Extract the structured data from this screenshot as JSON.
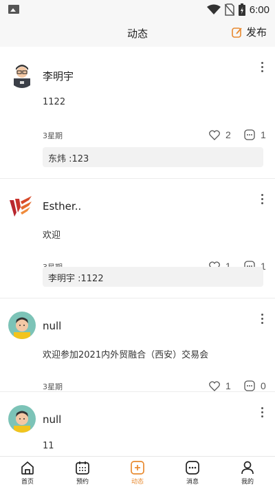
{
  "status_bar": {
    "time": "6:00"
  },
  "header": {
    "title": "动态",
    "publish_label": "发布"
  },
  "accent_color": "#e8892e",
  "posts": [
    {
      "author": "李明宇",
      "content": "1122",
      "time": "3星期",
      "likes": "2",
      "comments": "1",
      "reply": "东炜 :123"
    },
    {
      "author": "Esther..",
      "content": "欢迎",
      "time": "3星期",
      "likes": "1",
      "comments": "1",
      "reply": "李明宇 :1122"
    },
    {
      "author": "null",
      "content": "欢迎参加2021内外贸融合（西安）交易会",
      "time": "3星期",
      "likes": "1",
      "comments": "0"
    },
    {
      "author": "null",
      "content": "11"
    }
  ],
  "tabs": [
    {
      "label": "首页",
      "icon": "home-icon"
    },
    {
      "label": "预约",
      "icon": "calendar-icon"
    },
    {
      "label": "动态",
      "icon": "plus-square-icon",
      "active": true
    },
    {
      "label": "消息",
      "icon": "message-icon"
    },
    {
      "label": "我的",
      "icon": "user-icon"
    }
  ]
}
